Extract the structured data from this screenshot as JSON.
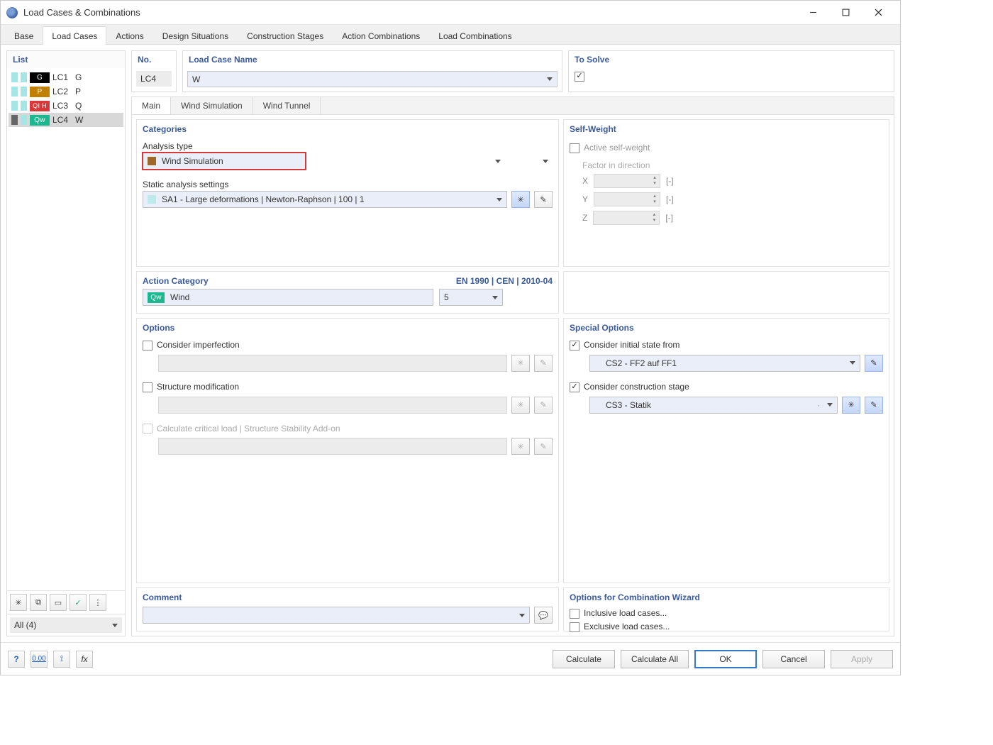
{
  "window": {
    "title": "Load Cases & Combinations"
  },
  "tabs": [
    "Base",
    "Load Cases",
    "Actions",
    "Design Situations",
    "Construction Stages",
    "Action Combinations",
    "Load Combinations"
  ],
  "activeTab": 1,
  "list": {
    "header": "List",
    "items": [
      {
        "tag": "G",
        "tagClass": "G",
        "id": "LC1",
        "ab": "G",
        "sel": false,
        "sw1": "aqua",
        "sw2": "aqua"
      },
      {
        "tag": "P",
        "tagClass": "P",
        "id": "LC2",
        "ab": "P",
        "sel": false,
        "sw1": "aqua",
        "sw2": "aqua"
      },
      {
        "tag": "QI H",
        "tagClass": "QIH",
        "id": "LC3",
        "ab": "Q",
        "sel": false,
        "sw1": "aqua",
        "sw2": "aqua"
      },
      {
        "tag": "Qw",
        "tagClass": "Qw",
        "id": "LC4",
        "ab": "W",
        "sel": true,
        "sw1": "dark",
        "sw2": "aqua"
      }
    ],
    "allLabel": "All (4)"
  },
  "header": {
    "no": {
      "label": "No.",
      "value": "LC4"
    },
    "name": {
      "label": "Load Case Name",
      "value": "W"
    },
    "solve": {
      "label": "To Solve",
      "checked": true
    }
  },
  "subtabs": [
    "Main",
    "Wind Simulation",
    "Wind Tunnel"
  ],
  "activeSubtab": 0,
  "categories": {
    "title": "Categories",
    "analysisTypeLabel": "Analysis type",
    "analysisType": "Wind Simulation",
    "staticLabel": "Static analysis settings",
    "static": "SA1 - Large deformations | Newton-Raphson | 100 | 1"
  },
  "selfWeight": {
    "title": "Self-Weight",
    "activeLabel": "Active self-weight",
    "factorLabel": "Factor in direction",
    "axes": [
      "X",
      "Y",
      "Z"
    ],
    "unit": "[-]"
  },
  "actionCategory": {
    "title": "Action Category",
    "standard": "EN 1990 | CEN | 2010-04",
    "tag": "Qw",
    "name": "Wind",
    "number": "5"
  },
  "options": {
    "title": "Options",
    "imperfection": "Consider imperfection",
    "structMod": "Structure modification",
    "critLoad": "Calculate critical load | Structure Stability Add-on"
  },
  "specialOptions": {
    "title": "Special Options",
    "initState": {
      "label": "Consider initial state from",
      "checked": true,
      "value": "CS2 - FF2 auf FF1"
    },
    "constStage": {
      "label": "Consider construction stage",
      "checked": true,
      "value": "CS3 - Statik"
    }
  },
  "wizard": {
    "title": "Options for Combination Wizard",
    "inclusive": "Inclusive load cases...",
    "exclusive": "Exclusive load cases..."
  },
  "comment": {
    "title": "Comment"
  },
  "footerButtons": {
    "calc": "Calculate",
    "calcAll": "Calculate All",
    "ok": "OK",
    "cancel": "Cancel",
    "apply": "Apply"
  }
}
